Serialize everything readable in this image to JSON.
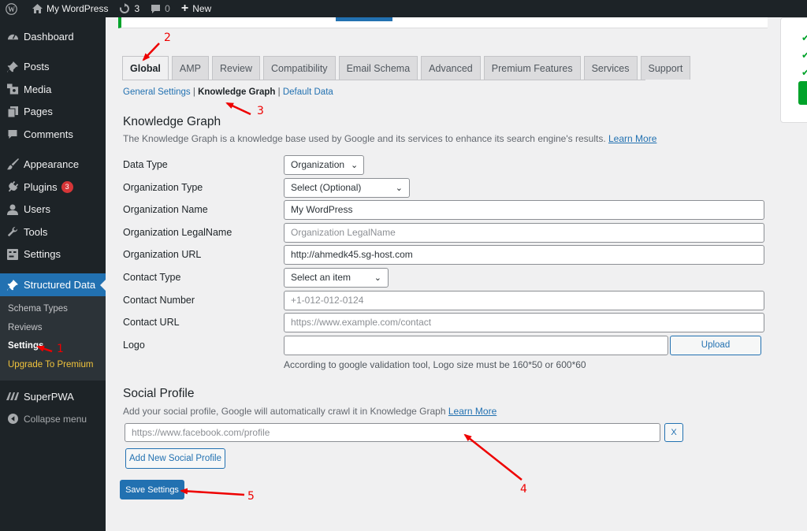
{
  "adminbar": {
    "site_name": "My WordPress",
    "updates_count": "3",
    "comments_count": "0",
    "new_label": "New"
  },
  "sidebar": {
    "items": [
      {
        "label": "Dashboard",
        "icon": "dashboard-icon"
      },
      {
        "label": "Posts",
        "icon": "pin-icon"
      },
      {
        "label": "Media",
        "icon": "media-icon"
      },
      {
        "label": "Pages",
        "icon": "pages-icon"
      },
      {
        "label": "Comments",
        "icon": "comments-icon"
      },
      {
        "label": "Appearance",
        "icon": "brush-icon"
      },
      {
        "label": "Plugins",
        "icon": "plugin-icon",
        "badge": "3"
      },
      {
        "label": "Users",
        "icon": "users-icon"
      },
      {
        "label": "Tools",
        "icon": "wrench-icon"
      },
      {
        "label": "Settings",
        "icon": "settings-icon"
      },
      {
        "label": "Structured Data",
        "icon": "pin-icon"
      }
    ],
    "submenu": [
      "Schema Types",
      "Reviews",
      "Settings",
      "Upgrade To Premium"
    ],
    "after": [
      {
        "label": "SuperPWA",
        "icon": "superpwa-icon"
      },
      {
        "label": "Collapse menu",
        "icon": "collapse-icon"
      }
    ]
  },
  "tabs": [
    "Global",
    "AMP",
    "Review",
    "Compatibility",
    "Email Schema",
    "Advanced",
    "Premium Features",
    "Services",
    "Support"
  ],
  "subnav": {
    "general": "General Settings",
    "sep1": " | ",
    "knowledge": "Knowledge Graph",
    "sep2": " | ",
    "default": "Default Data"
  },
  "knowledge": {
    "title": "Knowledge Graph",
    "description": "The Knowledge Graph is a knowledge base used by Google and its services to enhance its search engine's results.",
    "learn_more": "Learn More"
  },
  "form": {
    "data_type": {
      "label": "Data Type",
      "value": "Organization"
    },
    "org_type": {
      "label": "Organization Type",
      "value": "Select (Optional)"
    },
    "org_name": {
      "label": "Organization Name",
      "value": "My WordPress"
    },
    "org_legal": {
      "label": "Organization LegalName",
      "placeholder": "Organization LegalName"
    },
    "org_url": {
      "label": "Organization URL",
      "value": "http://ahmedk45.sg-host.com"
    },
    "contact_type": {
      "label": "Contact Type",
      "value": "Select an item"
    },
    "contact_number": {
      "label": "Contact Number",
      "placeholder": "+1-012-012-0124"
    },
    "contact_url": {
      "label": "Contact URL",
      "placeholder": "https://www.example.com/contact"
    },
    "logo": {
      "label": "Logo",
      "upload": "Upload",
      "hint": "According to google validation tool, Logo size must be 160*50 or 600*60"
    }
  },
  "social": {
    "title": "Social Profile",
    "description": "Add your social profile, Google will automatically crawl it in Knowledge Graph",
    "learn_more": "Learn More",
    "placeholder": "https://www.facebook.com/profile",
    "remove": "X",
    "add": "Add New Social Profile"
  },
  "save_label": "Save Settings",
  "annotations": [
    "1",
    "2",
    "3",
    "4",
    "5"
  ],
  "colors": {
    "primary": "#2271b1",
    "annotation": "#e00000",
    "admin_dark": "#1d2327"
  }
}
